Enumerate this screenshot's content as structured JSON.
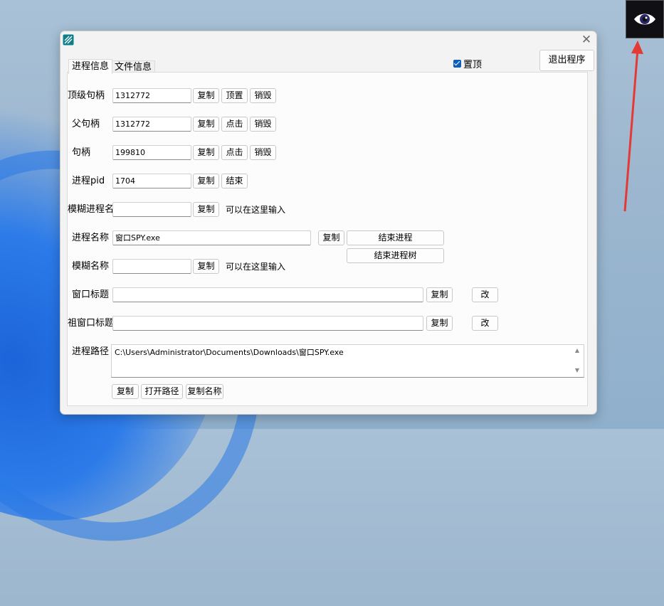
{
  "window": {
    "tabs": [
      "进程信息",
      "文件信息"
    ],
    "topmost_label": "置顶",
    "topmost_checked": true,
    "exit_label": "退出程序"
  },
  "rows": {
    "top_handle": {
      "label": "顶级句柄",
      "value": "1312772",
      "b1": "复制",
      "b2": "顶置",
      "b3": "销毁"
    },
    "parent_handle": {
      "label": "父句柄",
      "value": "1312772",
      "b1": "复制",
      "b2": "点击",
      "b3": "销毁"
    },
    "handle": {
      "label": "句柄",
      "value": "199810",
      "b1": "复制",
      "b2": "点击",
      "b3": "销毁"
    },
    "pid": {
      "label": "进程pid",
      "value": "1704",
      "b1": "复制",
      "b2": "结束"
    },
    "fuzzy_process": {
      "label": "模糊进程名",
      "value": "",
      "b1": "复制",
      "hint": "可以在这里输入"
    },
    "process_name": {
      "label": "进程名称",
      "value": "窗口SPY.exe",
      "b1": "复制",
      "b2": "结束进程",
      "b3": "结束进程树"
    },
    "fuzzy_name": {
      "label": "模糊名称",
      "value": "",
      "b1": "复制",
      "hint": "可以在这里输入"
    },
    "window_title": {
      "label": "窗口标题",
      "value": "",
      "b1": "复制",
      "b2": "改"
    },
    "root_title": {
      "label": "祖窗口标题",
      "value": "",
      "b1": "复制",
      "b2": "改"
    },
    "path": {
      "label": "进程路径",
      "value": "C:\\Users\\Administrator\\Documents\\Downloads\\窗口SPY.exe"
    }
  },
  "bottom_buttons": [
    "复制",
    "打开路径",
    "复制名称"
  ],
  "colors": {
    "accent": "#0a5fbd",
    "arrow": "#e53935"
  },
  "icons": {
    "app": "app-icon",
    "close": "close-icon",
    "eye": "eye-icon",
    "arrow": "red-arrow-annotation"
  }
}
